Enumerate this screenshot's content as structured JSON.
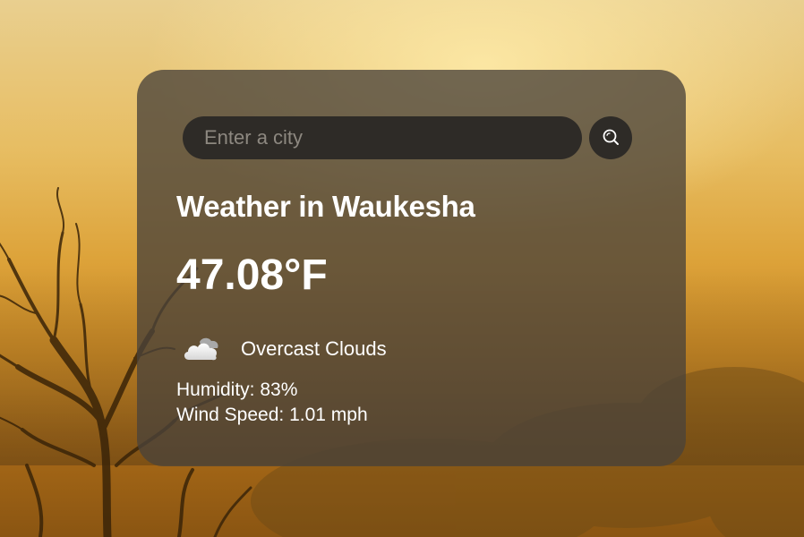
{
  "search": {
    "placeholder": "Enter a city",
    "value": "",
    "button_icon": "search-icon"
  },
  "weather": {
    "title": "Weather in Waukesha",
    "temperature": "47.08°F",
    "condition_icon": "cloud-icon",
    "description": "Overcast Clouds",
    "humidity_label": "Humidity:",
    "humidity_value": "83%",
    "wind_label": "Wind Speed:",
    "wind_value": "1.01 mph"
  },
  "colors": {
    "card_background": "#4a423a",
    "input_background": "#2e2b27",
    "text": "#ffffff",
    "background_accent": "#dda33a"
  }
}
